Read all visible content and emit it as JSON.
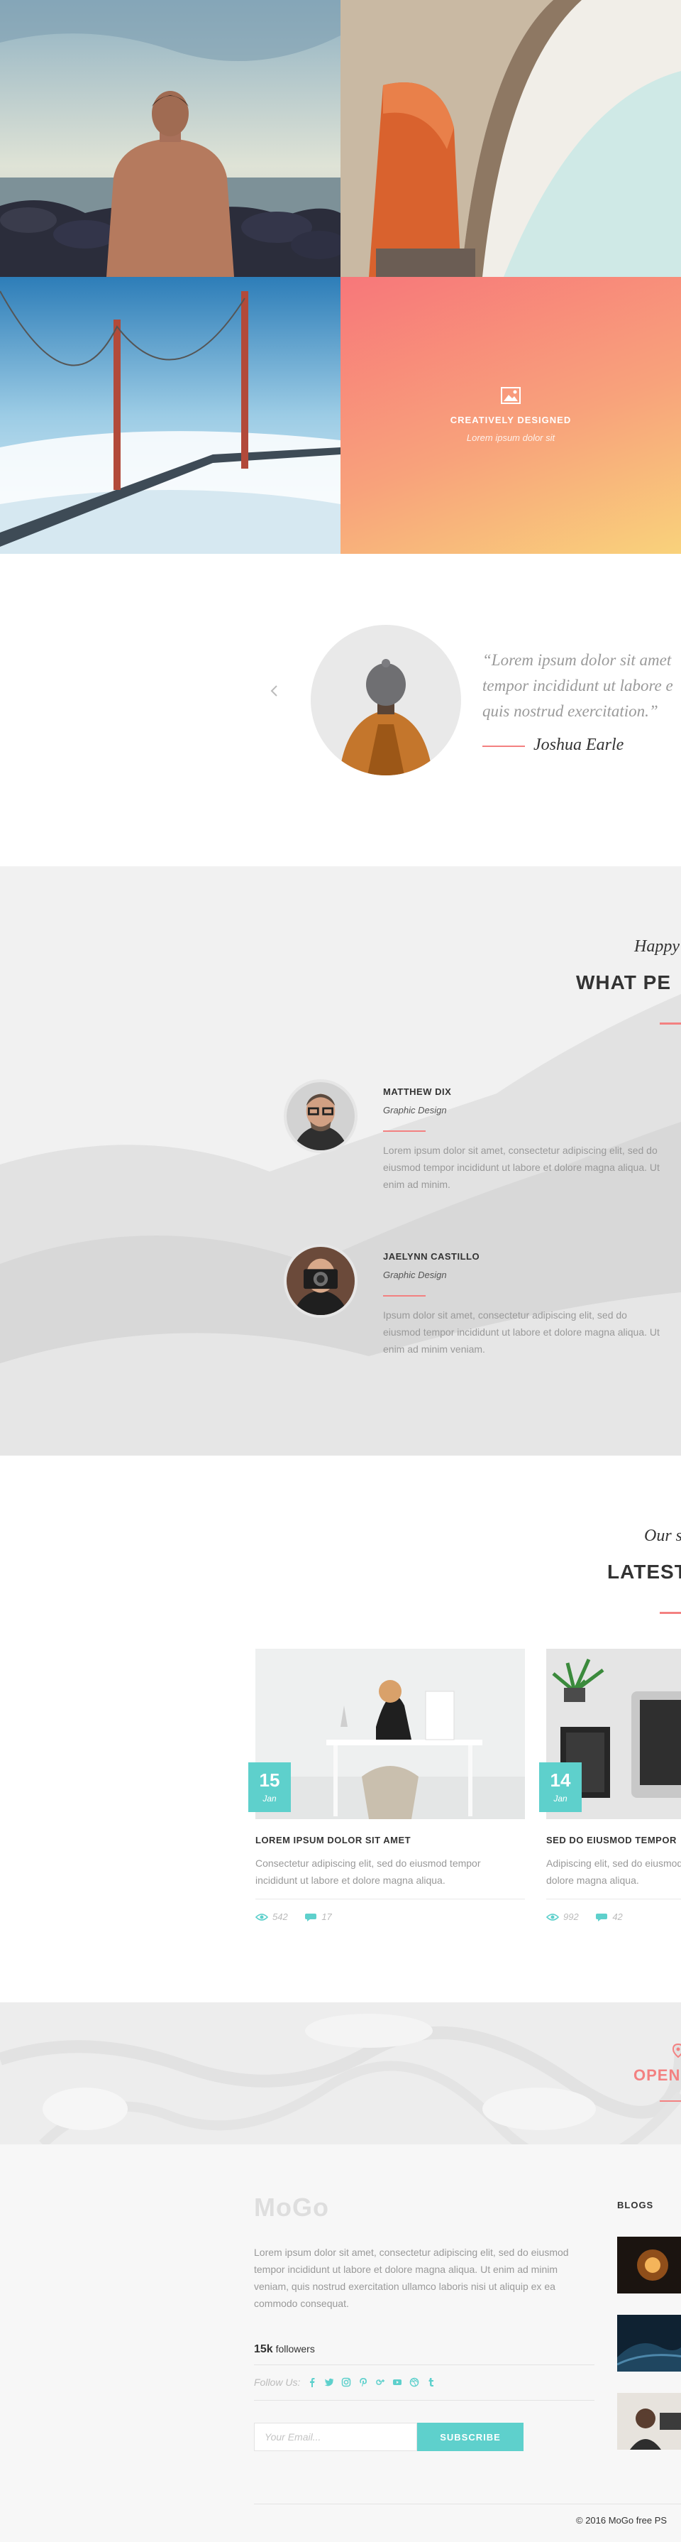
{
  "gallery": {
    "tiles": [
      {
        "name": "man-by-sea",
        "caption_title": "",
        "caption_sub": ""
      },
      {
        "name": "architecture",
        "caption_title": "",
        "caption_sub": ""
      },
      {
        "name": "golden-gate-bridge",
        "caption_title": "",
        "caption_sub": ""
      },
      {
        "name": "overlay-tile",
        "caption_title": "CREATIVELY DESIGNED",
        "caption_sub": "Lorem ipsum dolor sit"
      }
    ]
  },
  "testimonial": {
    "quote_line1": "“Lorem ipsum dolor sit amet",
    "quote_line2": "tempor incididunt ut labore e",
    "quote_line3": "quis nostrud exercitation.”",
    "author": "Joshua Earle"
  },
  "clients": {
    "script": "Happy",
    "heading": "WHAT PE",
    "items": [
      {
        "name": "MATTHEW DIX",
        "role": "Graphic Design",
        "text": "Lorem ipsum dolor sit amet, consectetur adipiscing elit, sed do eiusmod tempor incididunt ut labore et dolore magna aliqua. Ut enim ad minim."
      },
      {
        "name": "JAELYNN CASTILLO",
        "role": "Graphic Design",
        "text": "Ipsum dolor sit amet, consectetur adipiscing elit, sed do eiusmod tempor incididunt ut labore et dolore magna aliqua. Ut enim ad minim veniam."
      }
    ]
  },
  "blog": {
    "script": "Our s",
    "heading": "LATEST",
    "posts": [
      {
        "day": "15",
        "month": "Jan",
        "title": "LOREM IPSUM DOLOR SIT AMET",
        "excerpt": "Consectetur adipiscing elit, sed do eiusmod tempor incididunt ut labore et dolore magna aliqua.",
        "views": "542",
        "comments": "17"
      },
      {
        "day": "14",
        "month": "Jan",
        "title": "SED DO EIUSMOD TEMPOR",
        "excerpt": "Adipiscing elit, sed do eiusmod tempor incididunt ut labore et dolore magna aliqua.",
        "views": "992",
        "comments": "42"
      }
    ]
  },
  "map": {
    "label": "OPEN",
    "icon": "location-pin-icon"
  },
  "footer": {
    "logo": "MoGo",
    "about": "Lorem ipsum dolor sit amet, consectetur adipiscing elit, sed do eiusmod tempor incididunt ut labore et dolore magna aliqua. Ut enim ad minim veniam, quis nostrud exercitation ullamco laboris nisi ut aliquip ex ea commodo consequat.",
    "followers_count": "15k",
    "followers_label": "followers",
    "follow_label": "Follow Us:",
    "social": [
      "facebook-icon",
      "twitter-icon",
      "instagram-icon",
      "pinterest-icon",
      "google-plus-icon",
      "youtube-icon",
      "dribbble-icon",
      "tumblr-icon"
    ],
    "email_placeholder": "Your Email...",
    "subscribe_label": "SUBSCRIBE",
    "blogs_title": "BLOGS",
    "copyright": "© 2016 MoGo free PS"
  },
  "colors": {
    "accent_teal": "#5ed0cc",
    "accent_coral": "#f38181"
  }
}
